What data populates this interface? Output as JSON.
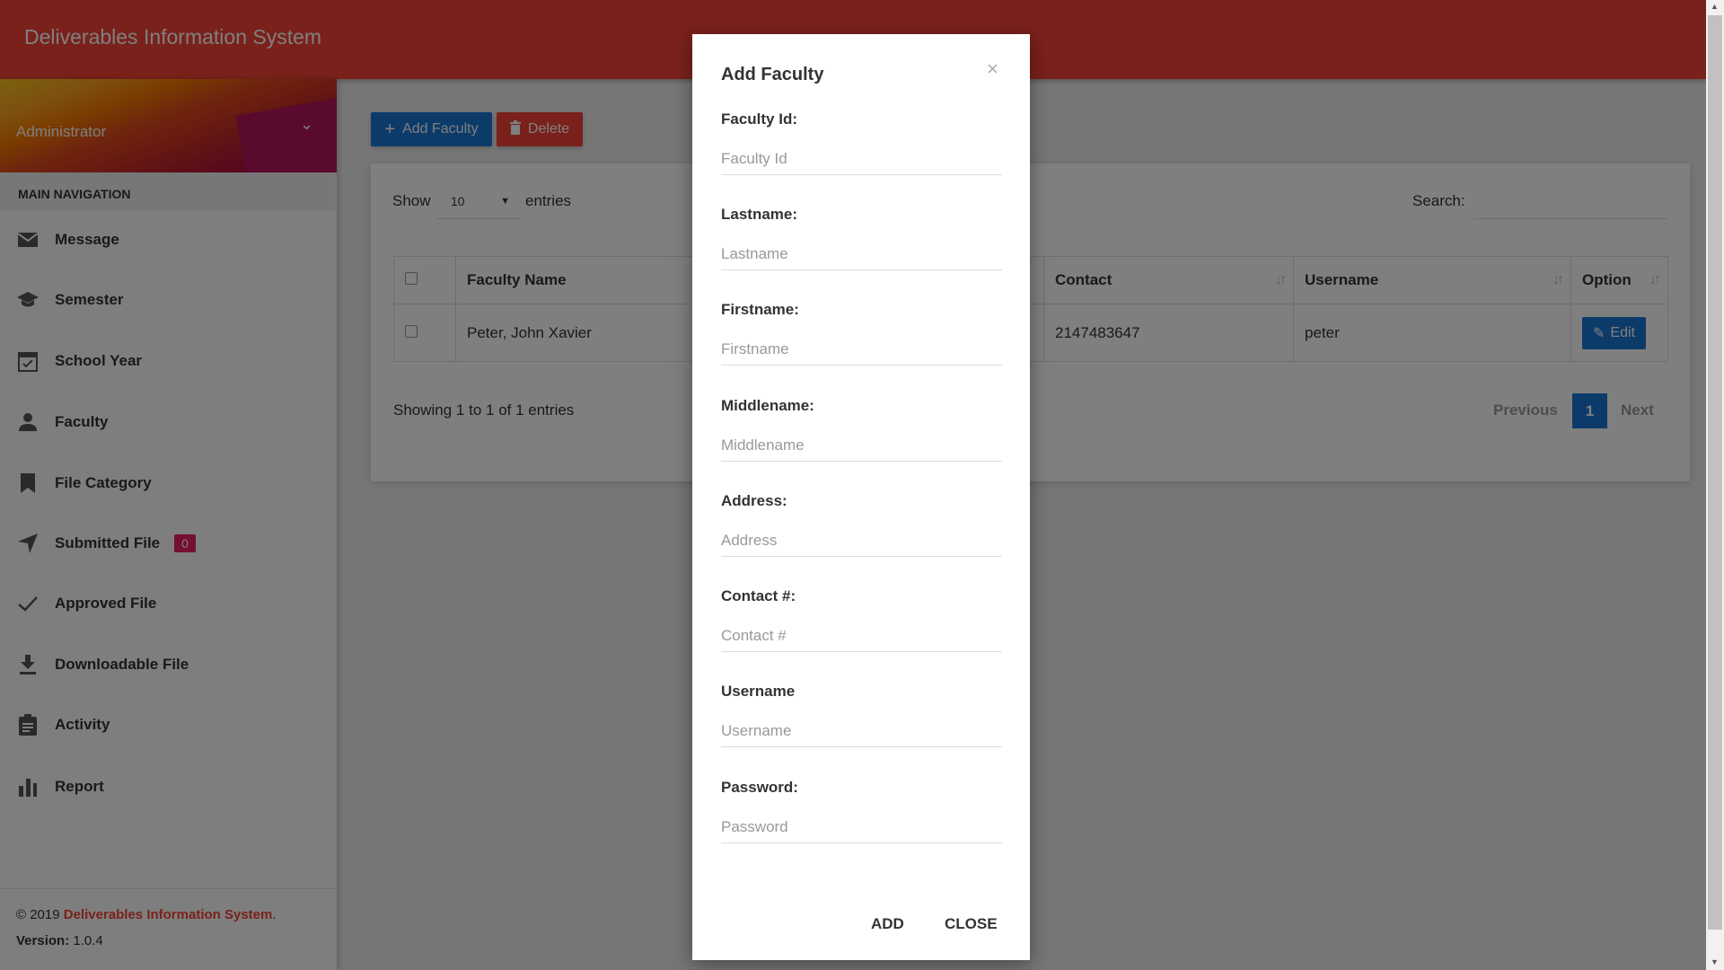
{
  "app": {
    "title": "Deliverables Information System"
  },
  "user": {
    "name": "Administrator"
  },
  "sidebar": {
    "heading": "MAIN NAVIGATION",
    "items": [
      {
        "label": "Message",
        "icon": "envelope-icon"
      },
      {
        "label": "Semester",
        "icon": "graduation-cap-icon"
      },
      {
        "label": "School Year",
        "icon": "calendar-check-icon"
      },
      {
        "label": "Faculty",
        "icon": "person-icon"
      },
      {
        "label": "File Category",
        "icon": "bookmark-icon"
      },
      {
        "label": "Submitted File",
        "icon": "send-icon",
        "badge": "0"
      },
      {
        "label": "Approved File",
        "icon": "check-icon"
      },
      {
        "label": "Downloadable File",
        "icon": "download-icon"
      },
      {
        "label": "Activity",
        "icon": "clipboard-icon"
      },
      {
        "label": "Report",
        "icon": "bar-chart-icon"
      }
    ],
    "footer": {
      "copyright": "© 2019",
      "brand": "Deliverables Information System",
      "dot": ".",
      "version_label": "Version:",
      "version": "1.0.4"
    }
  },
  "toolbar": {
    "add_label": "Add Faculty",
    "delete_label": "Delete"
  },
  "table": {
    "show_label": "Show",
    "entries_value": "10",
    "entries_label": "entries",
    "search_label": "Search:",
    "columns": [
      "Faculty Name",
      "Contact",
      "Username",
      "Option"
    ],
    "rows": [
      {
        "name": "Peter, John Xavier",
        "contact": "2147483647",
        "username": "peter",
        "edit": "Edit"
      }
    ],
    "info": "Showing 1 to 1 of 1 entries",
    "pagination": {
      "previous": "Previous",
      "current": "1",
      "next": "Next"
    }
  },
  "modal": {
    "title": "Add Faculty",
    "close_icon": "×",
    "fields": [
      {
        "label": "Faculty Id:",
        "placeholder": "Faculty Id"
      },
      {
        "label": "Lastname:",
        "placeholder": "Lastname"
      },
      {
        "label": "Firstname:",
        "placeholder": "Firstname"
      },
      {
        "label": "Middlename:",
        "placeholder": "Middlename"
      },
      {
        "label": "Address:",
        "placeholder": "Address"
      },
      {
        "label": "Contact #:",
        "placeholder": "Contact #"
      },
      {
        "label": "Username",
        "placeholder": "Username"
      },
      {
        "label": "Password:",
        "placeholder": "Password"
      }
    ],
    "add_label": "ADD",
    "close_label": "CLOSE"
  },
  "colors": {
    "header": "#f44336",
    "primary": "#1976d2",
    "danger": "#f44336",
    "badge": "#e91e63"
  }
}
